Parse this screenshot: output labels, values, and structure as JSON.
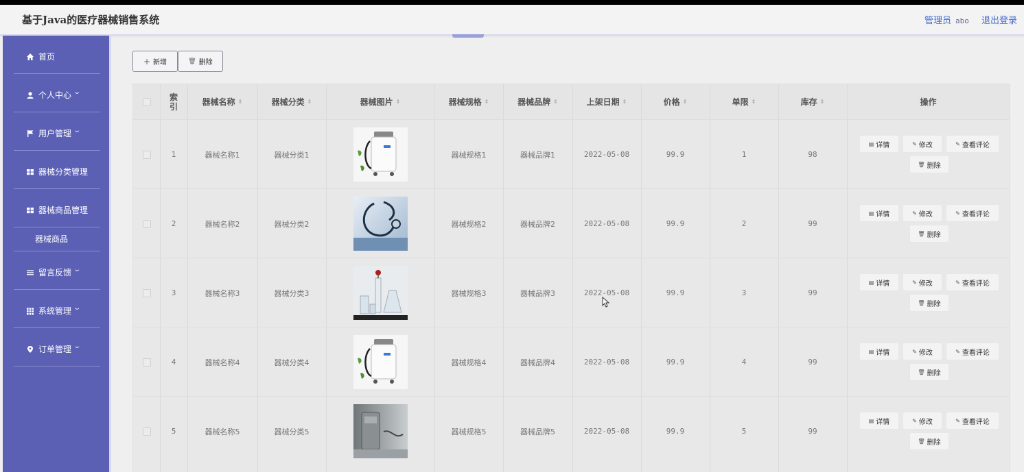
{
  "app": {
    "title": "基于Java的医疗器械销售系统"
  },
  "header": {
    "role": "管理员",
    "username": "abo",
    "logout": "退出登录"
  },
  "sidebar": {
    "items": [
      {
        "label": "首页",
        "icon": "home-icon",
        "chevron": false
      },
      {
        "label": "个人中心",
        "icon": "user-icon",
        "chevron": true
      },
      {
        "label": "用户管理",
        "icon": "flag-icon",
        "chevron": true
      },
      {
        "label": "器械分类管理",
        "icon": "grid-icon",
        "chevron": true
      },
      {
        "label": "器械商品管理",
        "icon": "grid-icon",
        "chevron": true
      },
      {
        "label": "留言反馈",
        "icon": "list-icon",
        "chevron": true
      },
      {
        "label": "系统管理",
        "icon": "apps-icon",
        "chevron": true
      },
      {
        "label": "订单管理",
        "icon": "location-pin-icon",
        "chevron": true
      }
    ],
    "sub_item": "器械商品"
  },
  "toolbar": {
    "add_label": "新增",
    "delete_label": "删除"
  },
  "table": {
    "columns": {
      "index": "索引",
      "name": "器械名称",
      "category": "器械分类",
      "image": "器械图片",
      "spec": "器械规格",
      "brand": "器械品牌",
      "date": "上架日期",
      "price": "价格",
      "limit": "单限",
      "stock": "库存",
      "actions": "操作"
    },
    "actions": {
      "detail": "详情",
      "edit": "修改",
      "reviews": "查看评论",
      "delete": "删除"
    },
    "rows": [
      {
        "index": "1",
        "name": "器械名称1",
        "category": "器械分类1",
        "spec": "器械规格1",
        "brand": "器械品牌1",
        "date": "2022-05-08",
        "price": "99.9",
        "limit": "1",
        "stock": "98",
        "image": "cryo-machine"
      },
      {
        "index": "2",
        "name": "器械名称2",
        "category": "器械分类2",
        "spec": "器械规格2",
        "brand": "器械品牌2",
        "date": "2022-05-08",
        "price": "99.9",
        "limit": "2",
        "stock": "99",
        "image": "stethoscope"
      },
      {
        "index": "3",
        "name": "器械名称3",
        "category": "器械分类3",
        "spec": "器械规格3",
        "brand": "器械品牌3",
        "date": "2022-05-08",
        "price": "99.9",
        "limit": "3",
        "stock": "99",
        "image": "lab-glassware"
      },
      {
        "index": "4",
        "name": "器械名称4",
        "category": "器械分类4",
        "spec": "器械规格4",
        "brand": "器械品牌4",
        "date": "2022-05-08",
        "price": "99.9",
        "limit": "4",
        "stock": "99",
        "image": "cryo-machine"
      },
      {
        "index": "5",
        "name": "器械名称5",
        "category": "器械分类5",
        "spec": "器械规格5",
        "brand": "器械品牌5",
        "date": "2022-05-08",
        "price": "99.9",
        "limit": "5",
        "stock": "99",
        "image": "device-room"
      }
    ]
  },
  "colors": {
    "sidebar": "#5b60b5",
    "link": "#4a6fcf"
  }
}
